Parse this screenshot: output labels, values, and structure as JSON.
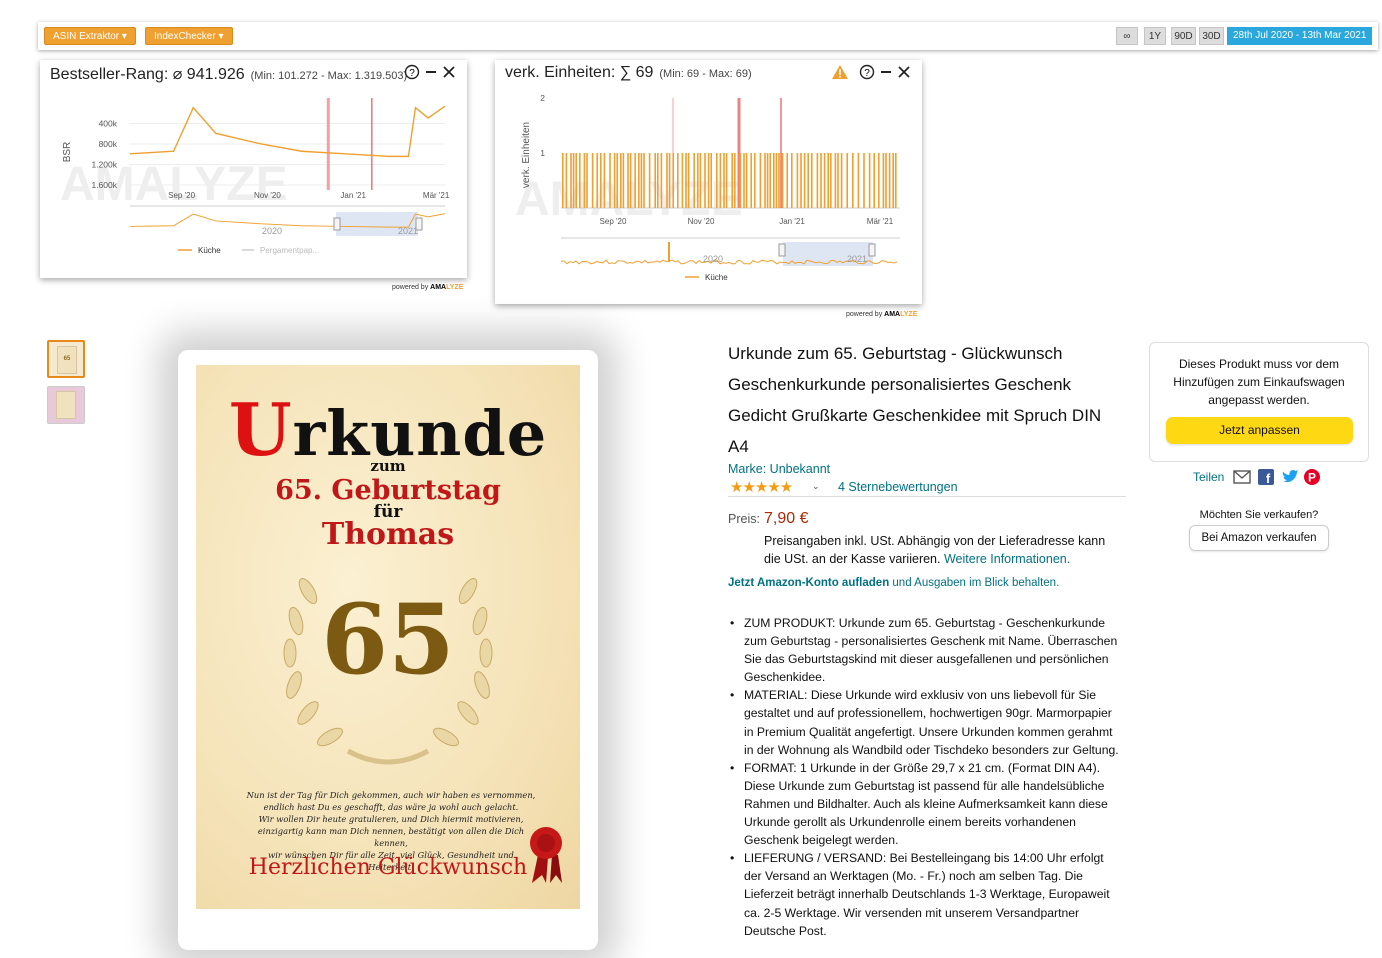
{
  "toolbar": {
    "asin_extractor": "ASIN Extraktor ▾",
    "index_checker": "IndexChecker ▾",
    "range_all": "∞",
    "range_1y": "1Y",
    "range_90d": "90D",
    "range_30d": "30D",
    "date_range": "28th Jul 2020 - 13th Mar 2021"
  },
  "colors": {
    "accent_orange": "#f0a030",
    "range_blue": "#2aa7dc",
    "link": "#007185",
    "price": "#b12704",
    "button_yellow": "#ffd814",
    "series": "#f0a030",
    "marker_red": "#e03030"
  },
  "bsr_widget": {
    "title": "Bestseller-Rang: ⌀ 941.926",
    "minmax": "(Min: 101.272 - Max: 1.319.503)",
    "watermark": "AMALYZE",
    "powered": "powered by",
    "brand_a": "AMA",
    "brand_b": "LYZE"
  },
  "units_widget": {
    "title": "verk. Einheiten: ∑ 69",
    "minmax": "(Min: 69 - Max: 69)",
    "watermark": "AMALYZE",
    "powered": "powered by",
    "brand_a": "AMA",
    "brand_b": "LYZE"
  },
  "chart_data": [
    {
      "type": "line",
      "ylabel": "BSR",
      "y_ticks": [
        "400k",
        "800k",
        "1.200k",
        "1.600k"
      ],
      "y_inverted": true,
      "x_ticks": [
        "Sep '20",
        "Nov '20",
        "Jan '21",
        "Mär '21"
      ],
      "navigator_label": "2020",
      "navigator_label2": "2021",
      "legend": [
        "Küche",
        "Pergamentpap..."
      ],
      "series": [
        {
          "name": "Küche",
          "x": [
            "2020-08-01",
            "2020-09-01",
            "2020-09-15",
            "2020-10-01",
            "2020-11-01",
            "2020-12-01",
            "2021-01-01",
            "2021-02-01",
            "2021-02-15",
            "2021-02-20",
            "2021-03-01",
            "2021-03-13"
          ],
          "values": [
            1050000,
            1000000,
            150000,
            650000,
            850000,
            1000000,
            1050000,
            1100000,
            1100000,
            150000,
            350000,
            120000
          ]
        }
      ]
    },
    {
      "type": "bar",
      "ylabel": "verk. Einheiten",
      "y_ticks": [
        "1",
        "2"
      ],
      "ylim": [
        0,
        2
      ],
      "x_ticks": [
        "Sep '20",
        "Nov '20",
        "Jan '21",
        "Mär '21"
      ],
      "navigator_label": "2020",
      "navigator_label2": "2021",
      "legend": [
        "Küche"
      ],
      "series": [
        {
          "name": "Küche",
          "values_note_free": true,
          "value_per_bar": 1
        }
      ]
    }
  ],
  "product": {
    "thumb_text": "65",
    "cert": {
      "title_first": "U",
      "title_rest": "rkunde",
      "line_zum": "zum",
      "line_birthday": "65. Geburtstag",
      "line_fuer": "für",
      "line_name": "Thomas",
      "number": "65",
      "verse_1": "Nun ist der Tag für Dich gekommen, auch wir haben es vernommen,",
      "verse_2": "endlich hast Du es geschafft, das wäre ja wohl auch gelacht.",
      "verse_3": "Wir wollen Dir heute gratulieren, und Dich hiermit motivieren,",
      "verse_4": "einzigartig kann man Dich nennen, bestätigt von allen die Dich kennen,",
      "verse_5": "wir wünschen Dir für alle Zeit, viel Glück, Gesundheit und Heiterkeit.",
      "footer": "Herzlichen Glückwunsch"
    },
    "title": "Urkunde zum 65. Geburtstag - Glückwunsch Geschenkurkunde personalisiertes Geschenk Gedicht Grußkarte Geschenkidee mit Spruch DIN A4",
    "brand": "Marke: Unbekannt",
    "stars": "★★★★★",
    "stars_caret": "⌄",
    "ratings": "4 Sternebewertungen",
    "price_label": "Preis:",
    "price": "7,90 €",
    "price_note": "Preisangaben inkl. USt. Abhängig von der Lieferadresse kann die USt. an der Kasse variieren.",
    "price_link": "Weitere Informationen.",
    "topup_bold": "Jetzt Amazon-Konto aufladen",
    "topup_rest": " und Ausgaben im Blick behalten.",
    "bullets": [
      "ZUM PRODUKT: Urkunde zum 65. Geburtstag - Geschenkurkunde zum Geburtstag - personalisiertes Geschenk mit Name. Überraschen Sie das Geburtstagskind mit dieser ausgefallenen und persönlichen Geschenkidee.",
      "MATERIAL: Diese Urkunde wird exklusiv von uns liebevoll für Sie gestaltet und auf professionellem, hochwertigen 90gr. Marmorpapier in Premium Qualität angefertigt. Unsere Urkunden kommen gerahmt in der Wohnung als Wandbild oder Tischdeko besonders zur Geltung.",
      "FORMAT: 1 Urkunde in der Größe 29,7 x 21 cm. (Format DIN A4). Diese Urkunde zum Geburtstag ist passend für alle handelsübliche Rahmen und Bildhalter. Auch als kleine Aufmerksamkeit kann diese Urkunde gerollt als Urkundenrolle einem bereits vorhandenen Geschenk beigelegt werden.",
      "LIEFERUNG / VERSAND: Bei Bestelleingang bis 14:00 Uhr erfolgt der Versand an Werktagen (Mo. - Fr.) noch am selben Tag. Die Lieferzeit beträgt innerhalb Deutschlands 1-3 Werktage, Europaweit ca. 2-5 Werktage. Wir versenden mit unserem Versandpartner Deutsche Post."
    ]
  },
  "buybox": {
    "text": "Dieses Produkt muss vor dem Hinzufügen zum Einkaufswagen angepasst werden.",
    "button": "Jetzt anpassen",
    "share": "Teilen",
    "sell_label": "Möchten Sie verkaufen?",
    "sell_button": "Bei Amazon verkaufen"
  }
}
